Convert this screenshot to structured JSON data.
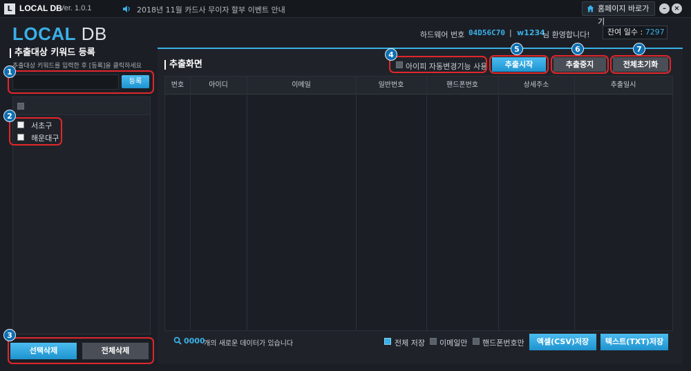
{
  "titlebar": {
    "logo_letter": "L",
    "app_name": "LOCAL DB",
    "version": "Ver. 1.0.1",
    "notice": "2018년 11월 카드사 무이자 할부 이벤트 안내",
    "home_button": "홈페이지 바로가기",
    "minimize": "–",
    "close": "×"
  },
  "header": {
    "brand_part1": "LOCAL",
    "brand_part2": " DB",
    "hw_label": "하드웨어 번호",
    "hw_value": "04D56C70",
    "separator": "|",
    "user_id": "w1234",
    "welcome": "님 환영합니다!",
    "days_label": "잔여 일수 : ",
    "days_value": "7297"
  },
  "left": {
    "title": "추출대상 키워드 등록",
    "help": "추출대상 키워드를 입력한 후 [등록]을 클릭하세요",
    "input_value": "",
    "register_button": "등록",
    "keywords": [
      "서초구",
      "해운대구"
    ],
    "select_delete_button": "선택삭제",
    "delete_all_button": "전체삭제"
  },
  "main": {
    "title": "추출화면",
    "ip_option_label": "아이피 자동변경기능 사용",
    "start_button": "추출시작",
    "stop_button": "추출중지",
    "reset_button": "전체초기화",
    "columns": [
      "번호",
      "아이디",
      "이메일",
      "일반번호",
      "핸드폰번호",
      "상세주소",
      "추출일시"
    ],
    "status_count": "0000",
    "status_text": "개의 새로운 데이터가 있습니다",
    "save_all_label": "전체 저장",
    "email_only_label": "이메일만",
    "phone_only_label": "핸드폰번호만",
    "csv_button": "엑셀(CSV)저장",
    "txt_button": "텍스트(TXT)저장"
  },
  "badges": [
    "1",
    "2",
    "3",
    "4",
    "5",
    "6",
    "7"
  ],
  "colors": {
    "accent": "#3ab0e8",
    "annotation": "#e3262b",
    "badge": "#0d6fb3"
  }
}
